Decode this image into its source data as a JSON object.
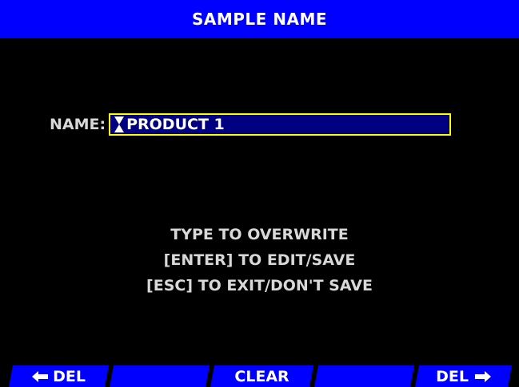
{
  "window": {
    "title": "SAMPLE NAME"
  },
  "name_field": {
    "label": "NAME:",
    "value": "PRODUCT 1"
  },
  "instructions": [
    "TYPE TO OVERWRITE",
    "[ENTER] TO EDIT/SAVE",
    "[ESC] TO EXIT/DON'T SAVE"
  ],
  "function_keys": {
    "f1": "DEL",
    "f2": "",
    "f3": "CLEAR",
    "f4": "",
    "f5": "DEL",
    "f1_icon": "left-arrow-icon",
    "f5_icon": "right-arrow-icon"
  },
  "colors": {
    "title_bar": "#0000ff",
    "background": "#000000",
    "field_fill": "#000080",
    "field_border": "#ffff00",
    "text": "#d8d8d8",
    "fkey_fill": "#0000ff"
  }
}
